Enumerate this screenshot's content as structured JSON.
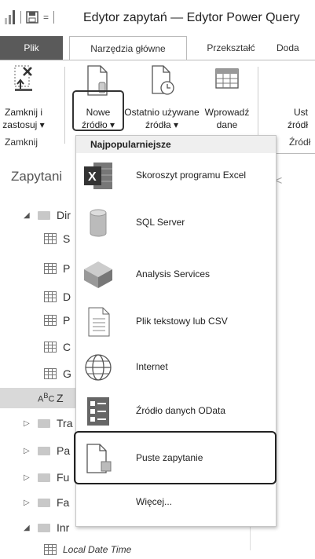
{
  "window": {
    "title": "Edytor zapytań — Edytor Power Query"
  },
  "tabs": [
    {
      "label": "Plik"
    },
    {
      "label": "Narzędzia główne"
    },
    {
      "label": "Przekształć"
    },
    {
      "label": "Doda"
    }
  ],
  "ribbon": {
    "close_apply": {
      "line1": "Zamknij i",
      "line2": "zastosuj ▾"
    },
    "new_source": {
      "line1": "Nowe",
      "line2": "źródło ▾"
    },
    "recent_sources": {
      "line1": "Ostatnio używane",
      "line2": "źródła ▾"
    },
    "enter_data": {
      "line1": "Wprowadź",
      "line2": "dane"
    },
    "data_source_settings": {
      "line1": "Ust",
      "line2": "źródł"
    },
    "groups": {
      "close": "Zamknij",
      "sources": "Źródł"
    }
  },
  "queries_pane": {
    "title": "Zapytani",
    "rows": [
      {
        "label": "Dir",
        "kind": "folder-open"
      },
      {
        "label": "S",
        "kind": "table"
      },
      {
        "label": "P",
        "kind": "table"
      },
      {
        "label": "D",
        "kind": "table"
      },
      {
        "label": "P",
        "kind": "table"
      },
      {
        "label": "C",
        "kind": "table"
      },
      {
        "label": "G",
        "kind": "table"
      },
      {
        "label": "Z",
        "kind": "parameter"
      },
      {
        "label": "Tra",
        "kind": "folder-closed"
      },
      {
        "label": "Pa",
        "kind": "folder-closed"
      },
      {
        "label": "Fu",
        "kind": "folder-closed"
      },
      {
        "label": "Fa",
        "kind": "folder-closed"
      },
      {
        "label": "Inr",
        "kind": "folder-open"
      },
      {
        "label": "Local Date Time",
        "kind": "table"
      }
    ]
  },
  "dropdown": {
    "header": "Najpopularniejsze",
    "items": [
      {
        "label": "Skoroszyt programu Excel",
        "icon": "excel-icon"
      },
      {
        "label": "SQL Server",
        "icon": "database-icon"
      },
      {
        "label": "Analysis Services",
        "icon": "cube-icon"
      },
      {
        "label": "Plik tekstowy lub CSV",
        "icon": "text-file-icon"
      },
      {
        "label": "Internet",
        "icon": "globe-icon"
      },
      {
        "label": "Źródło danych OData",
        "icon": "odata-icon"
      },
      {
        "label": "Puste zapytanie",
        "icon": "blank-query-icon"
      },
      {
        "label": "Więcej...",
        "icon": "more-icon"
      }
    ]
  },
  "colors": {
    "file_tab": "#5a5a5a",
    "excel_green": "#444444",
    "highlight_border": "#222222"
  }
}
